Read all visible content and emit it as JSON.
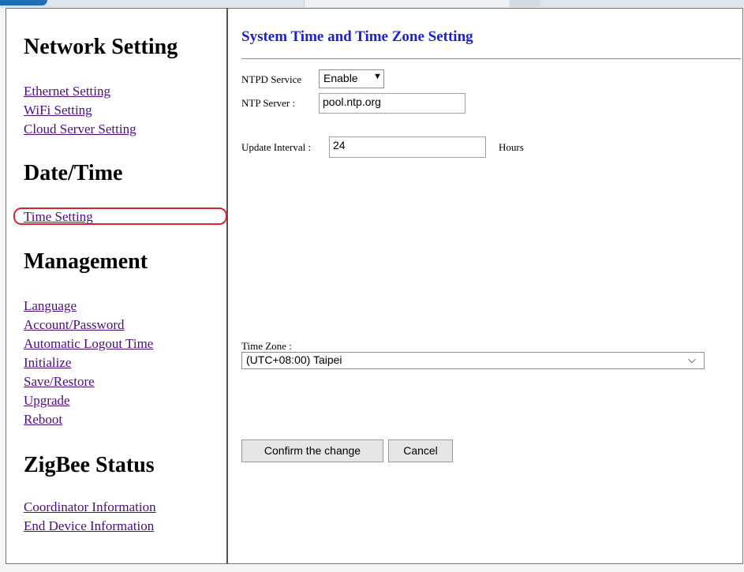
{
  "sidebar": {
    "network_heading": "Network Setting",
    "network_links": [
      "Ethernet Setting",
      "WiFi Setting",
      "Cloud Server Setting"
    ],
    "datetime_heading": "Date/Time",
    "datetime_links": [
      "Time Setting"
    ],
    "management_heading": "Management",
    "management_links": [
      "Language",
      "Account/Password",
      "Automatic Logout Time",
      "Initialize",
      "Save/Restore",
      "Upgrade",
      "Reboot"
    ],
    "zigbee_heading": "ZigBee Status",
    "zigbee_links": [
      "Coordinator Information",
      "End Device Information"
    ]
  },
  "main": {
    "title": "System Time and Time Zone Setting",
    "ntpd_label": "NTPD Service",
    "ntpd_value": "Enable",
    "ntp_server_label": "NTP Server :",
    "ntp_server_value": "pool.ntp.org",
    "update_interval_label": "Update Interval :",
    "update_interval_value": "24",
    "hours_label": "Hours",
    "timezone_label": "Time Zone :",
    "timezone_value": "(UTC+08:00) Taipei",
    "confirm_label": "Confirm the change",
    "cancel_label": "Cancel"
  },
  "colors": {
    "link": "#4b0d80",
    "title": "#1a20d6",
    "highlight": "#e0242c"
  }
}
